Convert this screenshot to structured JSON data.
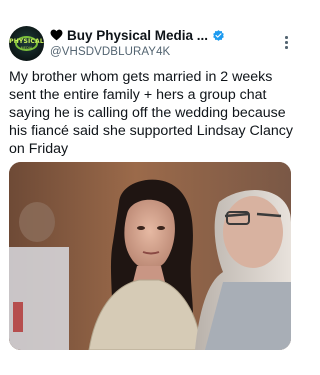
{
  "tweet": {
    "display_name": "Buy Physical Media ...",
    "handle": "@VHSDVDBLURAY4K",
    "body": "My brother whom gets married in 2 weeks sent the entire family + hers a group chat saying he is calling off the wedding because his fiancé said she supported Lindsay Clancy on Friday",
    "avatar_text": "PHYSICAL",
    "avatar_subtext": "MEDIA",
    "icons": {
      "heart": "black-heart-icon",
      "verified": "verified-badge-icon",
      "more": "more-options-icon"
    },
    "colors": {
      "verified": "#1d9bf0",
      "handle": "#536471",
      "text": "#0f1419"
    }
  }
}
